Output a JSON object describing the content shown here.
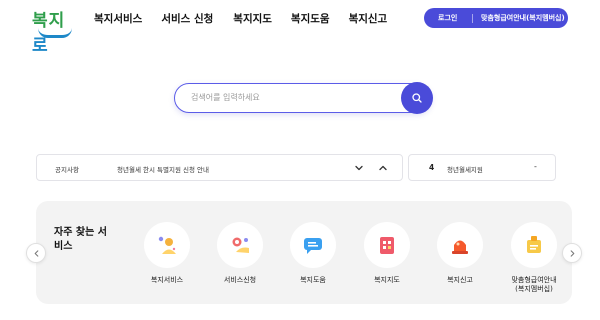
{
  "logo": {
    "text_part1": "복지",
    "text_part2": "로"
  },
  "nav": {
    "items": [
      "복지서비스",
      "서비스 신청",
      "복지지도",
      "복지도움",
      "복지신고"
    ]
  },
  "header_buttons": {
    "login": "로그인",
    "custom_guide": "맞춤형급여안내(복지멤버십)"
  },
  "search": {
    "placeholder": "검색어를 입력하세요"
  },
  "notice": {
    "label": "공지사항",
    "text": "청년월세 한시 특별지원 신청 안내"
  },
  "rank": {
    "number": "4",
    "text": "청년월세지원",
    "dash": "-"
  },
  "frequent": {
    "title": "자주 찾는 서비스",
    "items": [
      {
        "label": "복지서비스",
        "icon": "person-star-icon"
      },
      {
        "label": "서비스신청",
        "icon": "hand-form-icon"
      },
      {
        "label": "복지도움",
        "icon": "chat-bubble-icon"
      },
      {
        "label": "복지지도",
        "icon": "map-pins-icon"
      },
      {
        "label": "복지신고",
        "icon": "siren-icon"
      },
      {
        "label": "맞춤형급여안내\n(복지멤버십)",
        "icon": "gift-card-icon"
      }
    ]
  },
  "colors": {
    "primary": "#4a4bd9",
    "panel_bg": "#f3f3f3",
    "logo_green": "#2f9e4b",
    "logo_blue": "#1e88c8"
  }
}
